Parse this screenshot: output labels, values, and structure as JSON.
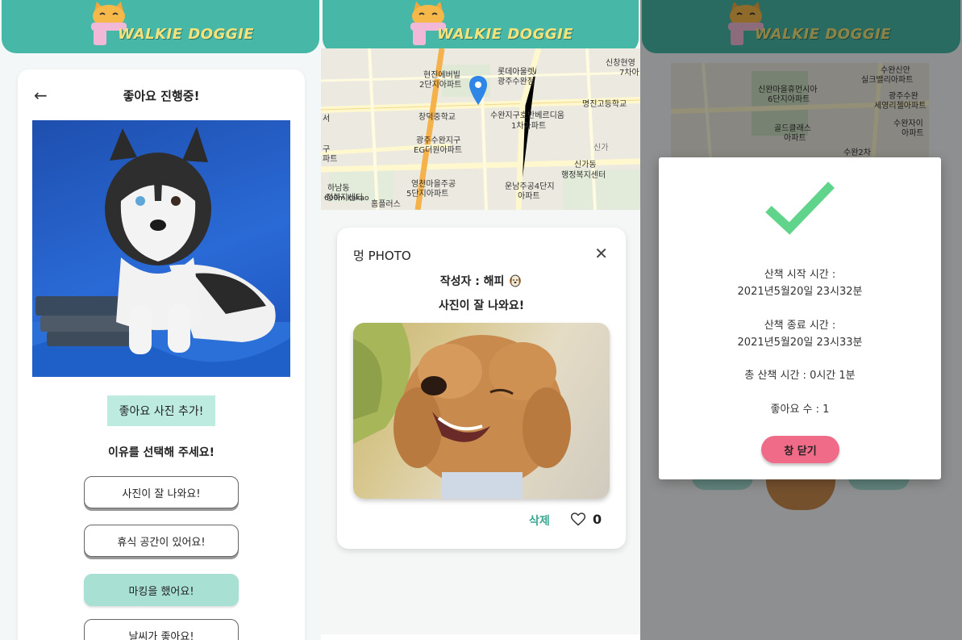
{
  "app": {
    "logo_text": "WALKIE DOGGIE"
  },
  "likes_screen": {
    "title": "좋아요 진행중!",
    "add_photo_label": "좋아요 사진 추가!",
    "reason_prompt": "이유를 선택해 주세요!",
    "reasons": [
      {
        "label": "사진이 잘 나와요!",
        "selected": false
      },
      {
        "label": "휴식 공간이 있어요!",
        "selected": false
      },
      {
        "label": "마킹을 했어요!",
        "selected": true
      },
      {
        "label": "날씨가 좋아요!",
        "selected": false
      }
    ]
  },
  "map": {
    "labels": [
      "신창현영",
      "7차아",
      "현진에버빌",
      "2단지아파트",
      "롯데아울렛",
      "광주수완점",
      "명진고등학교",
      "창덕중학교",
      "수완지구호반베르디움",
      "1차아파트",
      "광주수완지구",
      "EG더원아파트",
      "신가동",
      "행정복지센터",
      "영천마을주공",
      "5단지아파트",
      "운남주공4단지",
      "아파트",
      "하남동",
      "정복지센터",
      "홈플러스",
      "신가",
      "구",
      "파트",
      "서"
    ],
    "scale_text": "600m",
    "brand": "kakao"
  },
  "photo_card": {
    "title": "멍 PHOTO",
    "author": "작성자 : 해피",
    "caption": "사진이 잘 나와요!",
    "delete_label": "삭제",
    "likes": "0"
  },
  "map3": {
    "labels": [
      "수완신안",
      "실크밸리아파트",
      "신완마을휴먼시아",
      "6단지아파트",
      "광주수완",
      "세영리첼아파트",
      "수완자이",
      "아파트",
      "골드클래스",
      "아파트",
      "수완2차"
    ]
  },
  "walk_summary": {
    "start_label": "산책 시작 시간 :",
    "start_value": "2021년5월20일 23시32분",
    "end_label": "산책 종료 시간 :",
    "end_value": "2021년5월20일 23시33분",
    "total": "총 산책 시간 : 0시간 1분",
    "likes_count": "좋아요 수 : 1",
    "close_label": "창 닫기"
  },
  "colors": {
    "header": "#47b8a8",
    "selected_reason": "#a8e0d4",
    "add_photo": "#bdebe0",
    "delete": "#3aa893",
    "close_button": "#f06b88",
    "check": "#5fd48a"
  },
  "icons": [
    "cat-logo-icon",
    "back-arrow-icon",
    "location-pin-icon",
    "close-icon",
    "heart-icon",
    "dog-face-icon",
    "checkmark-icon"
  ]
}
